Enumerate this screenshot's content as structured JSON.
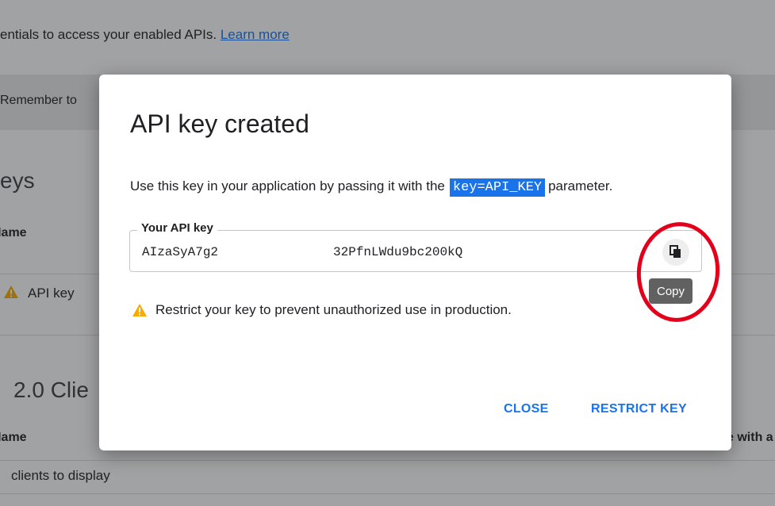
{
  "background": {
    "intro_text": "entials to access your enabled APIs.",
    "learn_more": "Learn more",
    "banner_text": "Remember to",
    "keys_heading": "eys",
    "name_header": "Name",
    "api_key_row": "API key",
    "clients_heading": "2.0 Clie",
    "name_header_2": "Name",
    "right_clip": "e with a",
    "no_clients": "clients to display"
  },
  "dialog": {
    "title": "API key created",
    "desc_prefix": "Use this key in your application by passing it with the",
    "desc_code": "key=API_KEY",
    "desc_suffix": "parameter.",
    "field_label": "Your API key",
    "key_part1": "AIzaSyA7g2",
    "key_part2": "32PfnLWdu9bc200kQ",
    "copy_tooltip": "Copy",
    "warning": "Restrict your key to prevent unauthorized use in production.",
    "close_label": "CLOSE",
    "restrict_label": "RESTRICT KEY"
  },
  "colors": {
    "accent": "#1a73e8",
    "warning": "#f9ab00",
    "annotation": "#e3001b"
  },
  "icons": {
    "copy": "copy-icon",
    "warning": "warning-icon"
  }
}
